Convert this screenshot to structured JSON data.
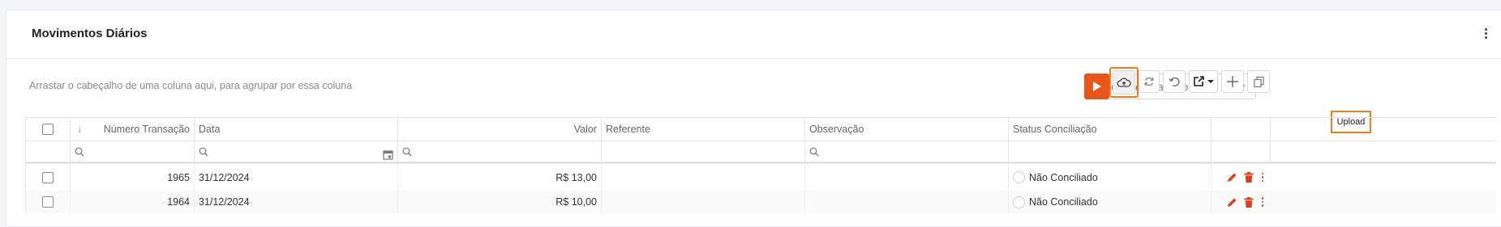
{
  "card": {
    "title": "Movimentos Diários"
  },
  "group_hint": "Arrastar o cabeçalho de uma coluna aqui, para agrupar por essa coluna",
  "toolbar": {
    "action_select": {
      "placeholder": "Selecione uma ação..."
    },
    "buttons": [
      {
        "name": "play",
        "icon": "play-icon",
        "accent": "#e8551a"
      },
      {
        "name": "upload",
        "icon": "cloud-upload-icon",
        "highlighted": true
      },
      {
        "name": "refresh",
        "icon": "refresh-icon"
      },
      {
        "name": "undo",
        "icon": "undo-icon"
      },
      {
        "name": "export",
        "icon": "export-icon"
      },
      {
        "name": "add",
        "icon": "plus-icon"
      },
      {
        "name": "copy",
        "icon": "copy-icon"
      }
    ],
    "tooltip": "Upload",
    "highlight_color": "#f07c1e"
  },
  "grid": {
    "columns": [
      "",
      "Número Transação",
      "Data",
      "Valor",
      "Referente",
      "Observação",
      "Status Conciliação",
      ""
    ],
    "sort_indicator": "↓",
    "rows": [
      {
        "numero": "1965",
        "data": "31/12/2024",
        "valor": "R$ 13,00",
        "referente": "",
        "observacao": "",
        "status": "Não Conciliado"
      },
      {
        "numero": "1964",
        "data": "31/12/2024",
        "valor": "R$ 10,00",
        "referente": "",
        "observacao": "",
        "status": "Não Conciliado"
      }
    ],
    "action_color": "#d9421c"
  }
}
